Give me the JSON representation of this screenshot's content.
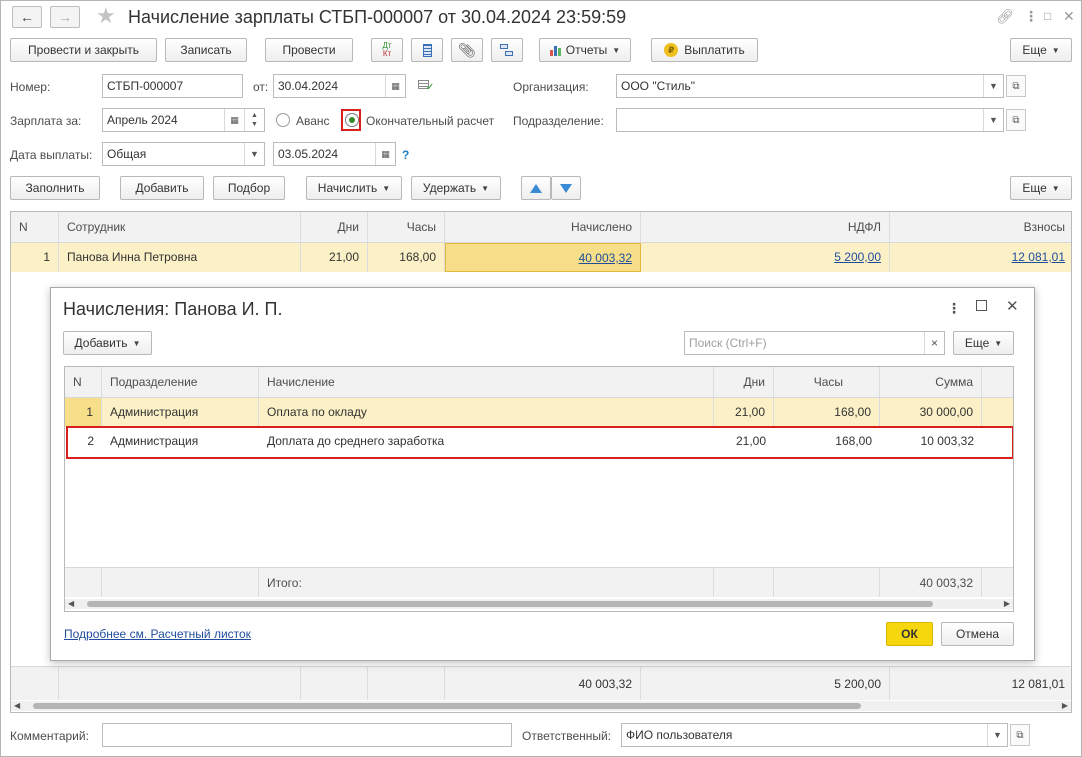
{
  "window": {
    "title": "Начисление зарплаты СТБП-000007 от 30.04.2024 23:59:59",
    "back_icon": "arrow-left",
    "forward_icon": "arrow-right"
  },
  "toolbar": {
    "post_close": "Провести и закрыть",
    "save": "Записать",
    "post": "Провести",
    "reports": "Отчеты",
    "pay": "Выплатить",
    "more": "Еще",
    "dt_kt_top": "Дт",
    "dt_kt_bottom": "Кт"
  },
  "form": {
    "number_label": "Номер:",
    "number_value": "СТБП-000007",
    "from_label": "от:",
    "date_value": "30.04.2024",
    "org_label": "Организация:",
    "org_value": "ООО \"Стиль\"",
    "salary_for_label": "Зарплата за:",
    "salary_for_value": "Апрель 2024",
    "advance_label": "Аванс",
    "final_label": "Окончательный расчет",
    "selected_mode": "final",
    "dept_label": "Подразделение:",
    "dept_value": "",
    "pay_date_label": "Дата выплаты:",
    "pay_date_mode": "Общая",
    "pay_date_value": "03.05.2024",
    "help": "?"
  },
  "table_toolbar": {
    "fill": "Заполнить",
    "add": "Добавить",
    "pick": "Подбор",
    "accrue": "Начислить",
    "withhold": "Удержать",
    "more": "Еще"
  },
  "main_table": {
    "columns": [
      "N",
      "Сотрудник",
      "Дни",
      "Часы",
      "Начислено",
      "НДФЛ",
      "Взносы"
    ],
    "rows": [
      {
        "n": "1",
        "employee": "Панова Инна Петровна",
        "days": "21,00",
        "hours": "168,00",
        "accrued": "40 003,32",
        "ndfl": "5 200,00",
        "contrib": "12 081,01"
      }
    ],
    "totals": {
      "accrued": "40 003,32",
      "ndfl": "5 200,00",
      "contrib": "12 081,01"
    }
  },
  "dialog": {
    "title": "Начисления: Панова И. П.",
    "add": "Добавить",
    "search_placeholder": "Поиск (Ctrl+F)",
    "clear": "×",
    "more": "Еще",
    "columns": [
      "N",
      "Подразделение",
      "Начисление",
      "Дни",
      "Часы",
      "Сумма"
    ],
    "rows": [
      {
        "n": "1",
        "dept": "Администрация",
        "accrual": "Оплата по окладу",
        "days": "21,00",
        "hours": "168,00",
        "sum": "30 000,00"
      },
      {
        "n": "2",
        "dept": "Администрация",
        "accrual": "Доплата до среднего заработка",
        "days": "21,00",
        "hours": "168,00",
        "sum": "10 003,32"
      }
    ],
    "total_label": "Итого:",
    "total_sum": "40 003,32",
    "details_link": "Подробнее см. Расчетный листок",
    "ok": "ОК",
    "cancel": "Отмена"
  },
  "bottom": {
    "comment_label": "Комментарий:",
    "comment_value": "",
    "responsible_label": "Ответственный:",
    "responsible_value": "ФИО пользователя"
  },
  "colors": {
    "selected_row": "#fbf0c6",
    "active_cell": "#f7de88",
    "highlight_border": "#d9201f",
    "ok_button": "#f6d60c",
    "link": "#1f4e9c"
  }
}
